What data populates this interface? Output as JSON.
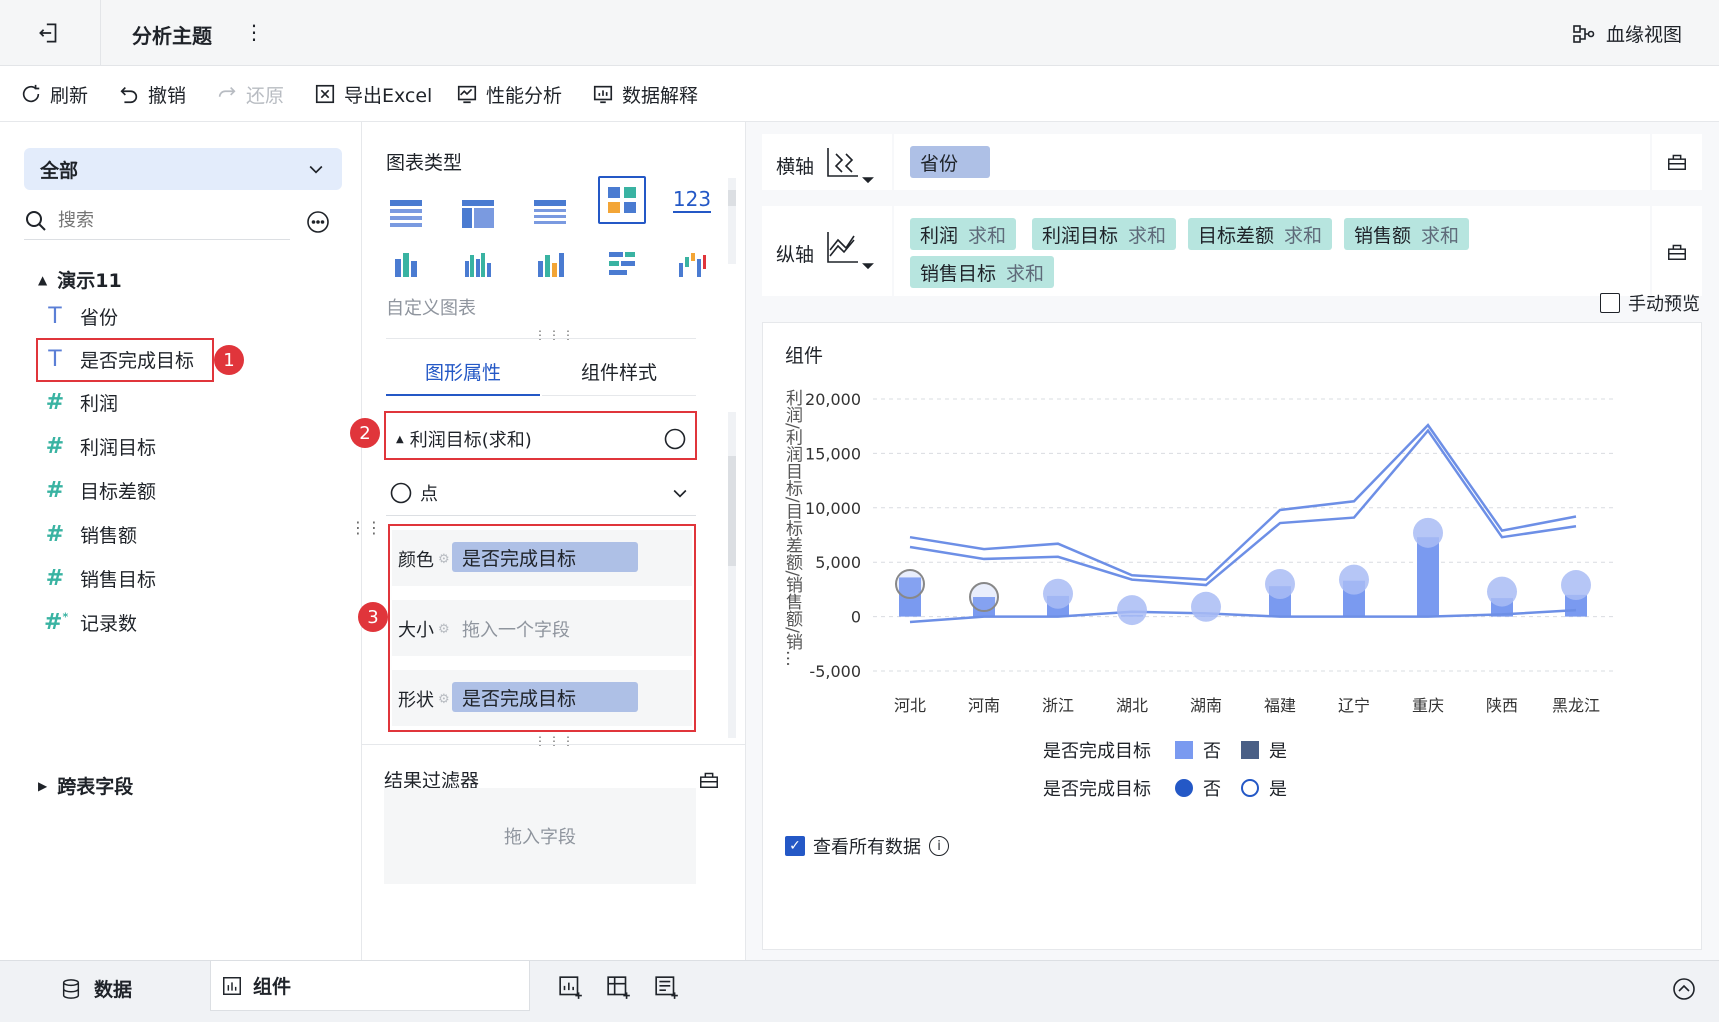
{
  "topbar": {
    "title": "分析主题",
    "more": "⋮",
    "lineage": "血缘视图"
  },
  "toolbar": {
    "refresh": "刷新",
    "undo": "撤销",
    "redo": "还原",
    "export": "导出Excel",
    "perf": "性能分析",
    "explain": "数据解释"
  },
  "left": {
    "scope": "全部",
    "search_placeholder": "搜索",
    "group": "演示11",
    "fields": [
      {
        "label": "省份"
      },
      {
        "label": "是否完成目标"
      },
      {
        "label": "利润"
      },
      {
        "label": "利润目标"
      },
      {
        "label": "目标差额"
      },
      {
        "label": "销售额"
      },
      {
        "label": "销售目标"
      },
      {
        "label": "记录数"
      }
    ],
    "cross": "跨表字段"
  },
  "badges": [
    "1",
    "2",
    "3"
  ],
  "mid": {
    "chart_type_title": "图表类型",
    "num_icon": "123",
    "custom": "自定义图表",
    "tab_props": "图形属性",
    "tab_style": "组件样式",
    "series_title": "利润目标(求和)",
    "mark_type": "点",
    "color_label": "颜色",
    "color_field": "是否完成目标",
    "size_label": "大小",
    "size_placeholder": "拖入一个字段",
    "shape_label": "形状",
    "shape_field": "是否完成目标",
    "filter_title": "结果过滤器",
    "filter_placeholder": "拖入字段"
  },
  "axes": {
    "x_label": "横轴",
    "x_field": "省份",
    "y_label": "纵轴",
    "y_fields": [
      {
        "name": "利润",
        "agg": "求和"
      },
      {
        "name": "利润目标",
        "agg": "求和"
      },
      {
        "name": "目标差额",
        "agg": "求和"
      },
      {
        "name": "销售额",
        "agg": "求和"
      },
      {
        "name": "销售目标",
        "agg": "求和"
      }
    ],
    "manual_preview": "手动预览"
  },
  "chart": {
    "title": "组件",
    "ylabel": "利润/利润目标/目标差额/销售额/销…",
    "legend1_title": "是否完成目标",
    "legend2_title": "是否完成目标",
    "no": "否",
    "yes": "是",
    "view_all": "查看所有数据",
    "info": "i"
  },
  "chart_data": {
    "type": "line",
    "categories": [
      "河北",
      "河南",
      "浙江",
      "湖北",
      "湖南",
      "福建",
      "辽宁",
      "重庆",
      "陕西",
      "黑龙江"
    ],
    "ylim": [
      -5000,
      20000
    ],
    "yticks": [
      "20,000",
      "15,000",
      "10,000",
      "5,000",
      "0",
      "-5,000"
    ],
    "series": [
      {
        "name": "利润",
        "mark": "bar",
        "values": [
          3600,
          1800,
          1900,
          150,
          100,
          2800,
          3300,
          7300,
          1700,
          2000
        ]
      },
      {
        "name": "利润目标",
        "mark": "point",
        "values": [
          3000,
          1800,
          2100,
          600,
          900,
          3000,
          3400,
          7700,
          2300,
          2900
        ]
      },
      {
        "name": "目标差额",
        "mark": "line",
        "values": [
          -500,
          0,
          0,
          450,
          300,
          0,
          0,
          0,
          200,
          600
        ]
      },
      {
        "name": "销售额",
        "mark": "line",
        "values": [
          7300,
          6200,
          6700,
          3800,
          3400,
          9800,
          10600,
          17600,
          7900,
          9200
        ]
      },
      {
        "name": "销售目标",
        "mark": "line",
        "values": [
          6400,
          5300,
          5500,
          3400,
          2900,
          8600,
          9100,
          17100,
          7300,
          8300
        ]
      }
    ],
    "colors": {
      "line": "#6d8fe6",
      "bar": "#7a9af0",
      "point": "#a9bcf5"
    }
  },
  "bottom": {
    "data_tab": "数据",
    "comp_tab": "组件"
  }
}
